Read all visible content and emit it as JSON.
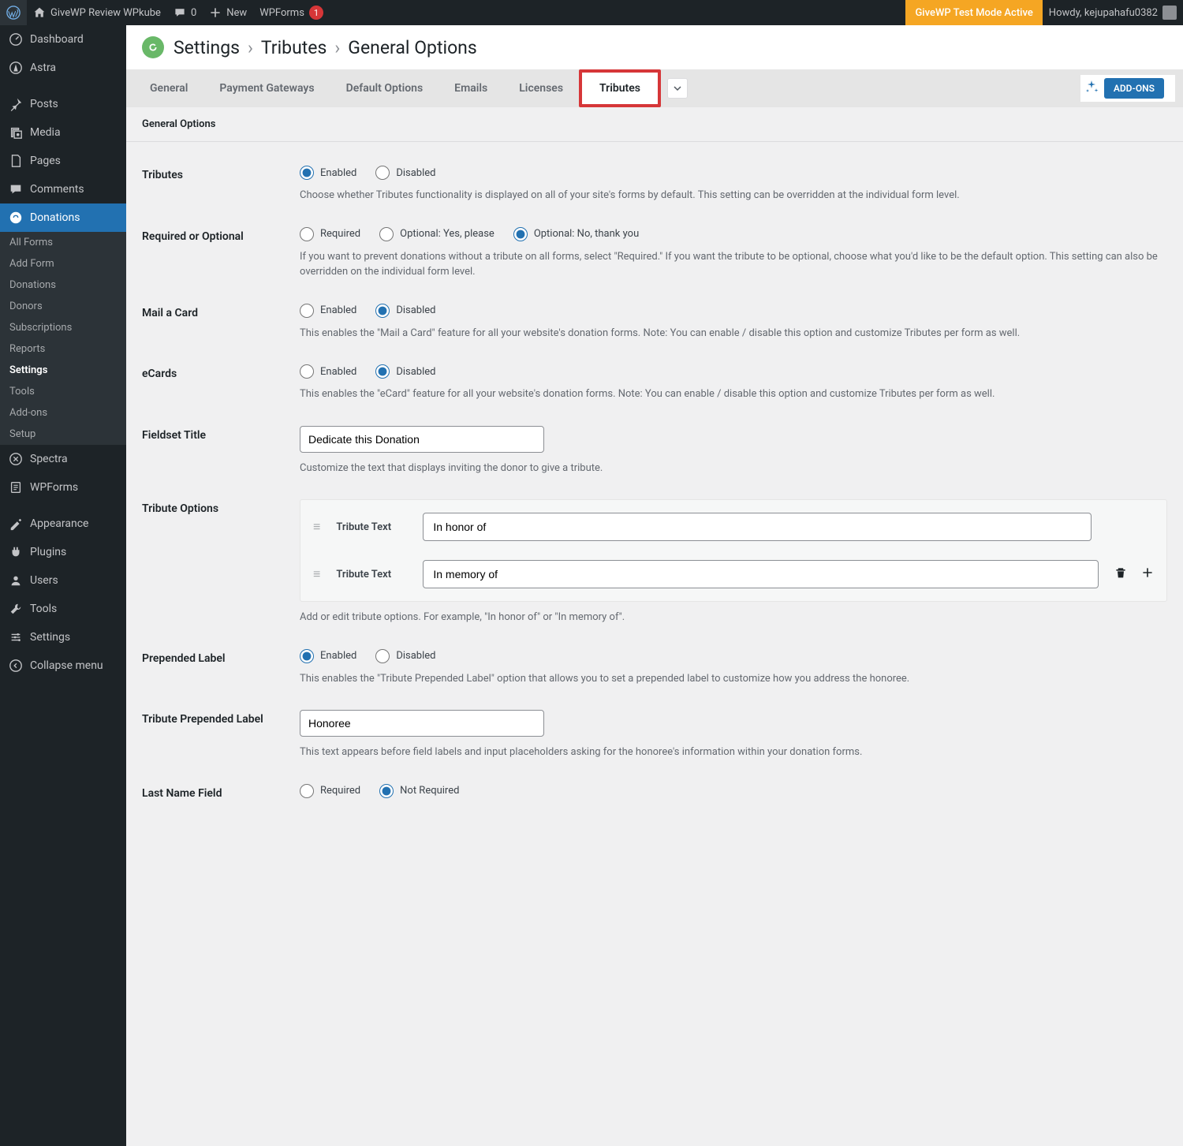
{
  "adminbar": {
    "site": "GiveWP Review WPkube",
    "comments": "0",
    "new": "New",
    "wpforms": "WPForms",
    "wpforms_badge": "1",
    "testmode": "GiveWP Test Mode Active",
    "howdy": "Howdy, kejupahafu0382"
  },
  "sidebar": {
    "items": [
      {
        "icon": "dashboard",
        "label": "Dashboard"
      },
      {
        "icon": "astra",
        "label": "Astra"
      },
      {
        "icon": "pin",
        "label": "Posts"
      },
      {
        "icon": "media",
        "label": "Media"
      },
      {
        "icon": "pages",
        "label": "Pages"
      },
      {
        "icon": "comments",
        "label": "Comments"
      },
      {
        "icon": "give",
        "label": "Donations",
        "active": true
      },
      {
        "icon": "spectra",
        "label": "Spectra"
      },
      {
        "icon": "wpforms",
        "label": "WPForms"
      },
      {
        "icon": "appearance",
        "label": "Appearance"
      },
      {
        "icon": "plugins",
        "label": "Plugins"
      },
      {
        "icon": "users",
        "label": "Users"
      },
      {
        "icon": "tools",
        "label": "Tools"
      },
      {
        "icon": "settings",
        "label": "Settings"
      },
      {
        "icon": "collapse",
        "label": "Collapse menu"
      }
    ],
    "sub": [
      "All Forms",
      "Add Form",
      "Donations",
      "Donors",
      "Subscriptions",
      "Reports",
      "Settings",
      "Tools",
      "Add-ons",
      "Setup"
    ],
    "sub_active": 6
  },
  "breadcrumb": {
    "a": "Settings",
    "b": "Tributes",
    "c": "General Options"
  },
  "tabs": [
    "General",
    "Payment Gateways",
    "Default Options",
    "Emails",
    "Licenses",
    "Tributes"
  ],
  "tabs_active": 5,
  "addons": "ADD-ONS",
  "subtab": "General Options",
  "settings": {
    "tributes": {
      "label": "Tributes",
      "opts": [
        "Enabled",
        "Disabled"
      ],
      "sel": 0,
      "desc": "Choose whether Tributes functionality is displayed on all of your site's forms by default. This setting can be overridden at the individual form level."
    },
    "required": {
      "label": "Required or Optional",
      "opts": [
        "Required",
        "Optional: Yes, please",
        "Optional: No, thank you"
      ],
      "sel": 2,
      "desc": "If you want to prevent donations without a tribute on all forms, select \"Required.\" If you want the tribute to be optional, choose what you'd like to be the default option. This setting can also be overridden on the individual form level."
    },
    "mailcard": {
      "label": "Mail a Card",
      "opts": [
        "Enabled",
        "Disabled"
      ],
      "sel": 1,
      "desc": "This enables the \"Mail a Card\" feature for all your website's donation forms. Note: You can enable / disable this option and customize Tributes per form as well."
    },
    "ecards": {
      "label": "eCards",
      "opts": [
        "Enabled",
        "Disabled"
      ],
      "sel": 1,
      "desc": "This enables the \"eCard\" feature for all your website's donation forms. Note: You can enable / disable this option and customize Tributes per form as well."
    },
    "fieldset": {
      "label": "Fieldset Title",
      "value": "Dedicate this Donation",
      "desc": "Customize the text that displays inviting the donor to give a tribute."
    },
    "tribute_options": {
      "label": "Tribute Options",
      "row_label": "Tribute Text",
      "rows": [
        "In honor of",
        "In memory of"
      ],
      "desc": "Add or edit tribute options. For example, \"In honor of\" or \"In memory of\"."
    },
    "prepended": {
      "label": "Prepended Label",
      "opts": [
        "Enabled",
        "Disabled"
      ],
      "sel": 0,
      "desc": "This enables the \"Tribute Prepended Label\" option that allows you to set a prepended label to customize how you address the honoree."
    },
    "prepended_text": {
      "label": "Tribute Prepended Label",
      "value": "Honoree",
      "desc": "This text appears before field labels and input placeholders asking for the honoree's information within your donation forms."
    },
    "lastname": {
      "label": "Last Name Field",
      "opts": [
        "Required",
        "Not Required"
      ],
      "sel": 1
    }
  }
}
